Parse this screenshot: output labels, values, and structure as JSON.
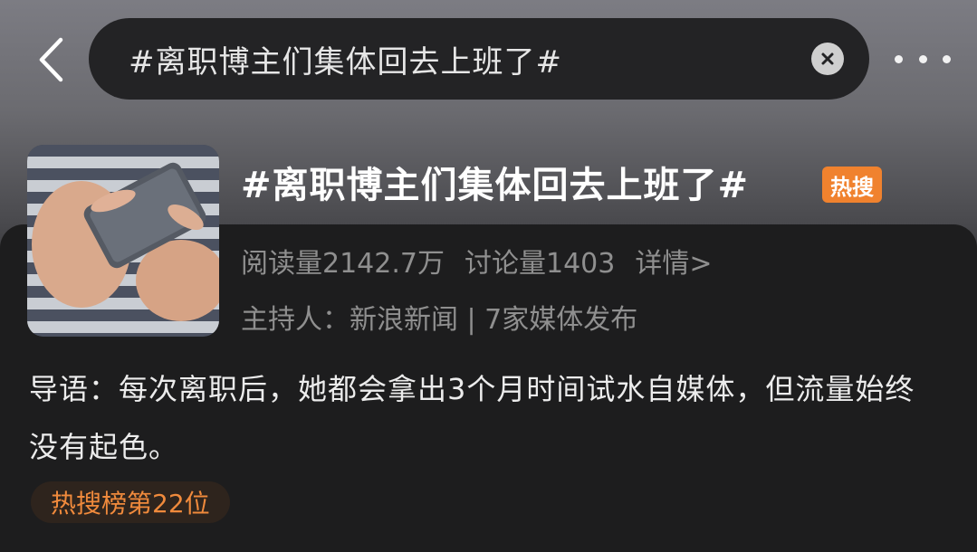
{
  "topbar": {
    "back_icon": "chevron-left-icon",
    "search_text": "#离职博主们集体回去上班了#",
    "clear_icon": "close-circle-icon",
    "more_icon": "more-dots-icon"
  },
  "topic": {
    "title": "#离职博主们集体回去上班了#",
    "badge": "热搜",
    "badge_color": "#f0822e",
    "read_count": "阅读量2142.7万",
    "discuss_count": "讨论量1403",
    "detail_link": "详情>",
    "host_line": "主持人：新浪新闻 | 7家媒体发布"
  },
  "intro": {
    "text": "导语：每次离职后，她都会拿出3个月时间试水自媒体，但流量始终没有起色。"
  },
  "rank": {
    "label": "热搜榜第22位",
    "color": "#f08a3c"
  }
}
